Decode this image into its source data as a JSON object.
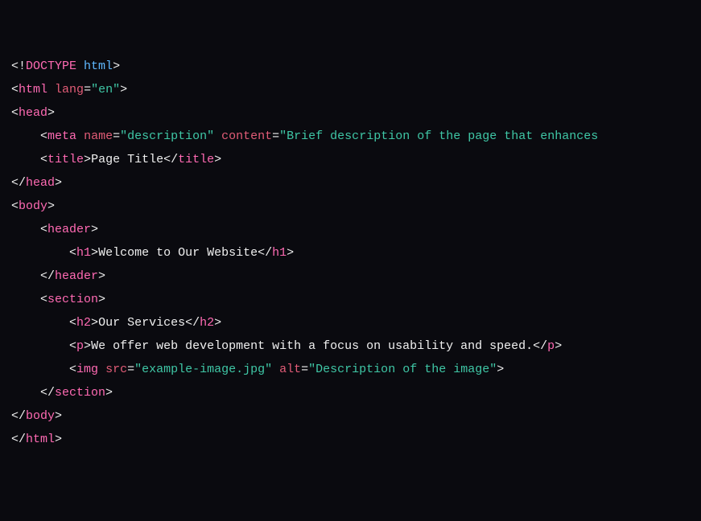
{
  "code": {
    "l1_open": "<!",
    "l1_doctype": "DOCTYPE",
    "l1_space": " ",
    "l1_html": "html",
    "l1_close": ">",
    "l2_open": "<",
    "l2_tag": "html",
    "l2_sp": " ",
    "l2_attr": "lang",
    "l2_eq": "=",
    "l2_val": "\"en\"",
    "l2_close": ">",
    "l3_open": "<",
    "l3_tag": "head",
    "l3_close": ">",
    "l4_indent": "    ",
    "l4_open": "<",
    "l4_tag": "meta",
    "l4_sp1": " ",
    "l4_attr1": "name",
    "l4_eq1": "=",
    "l4_val1": "\"description\"",
    "l4_sp2": " ",
    "l4_attr2": "content",
    "l4_eq2": "=",
    "l4_val2": "\"Brief description of the page that enhances ",
    "l5_indent": "    ",
    "l5_open": "<",
    "l5_tag": "title",
    "l5_close": ">",
    "l5_text": "Page Title",
    "l5_open2": "</",
    "l5_tag2": "title",
    "l5_close2": ">",
    "l6_open": "</",
    "l6_tag": "head",
    "l6_close": ">",
    "l7_open": "<",
    "l7_tag": "body",
    "l7_close": ">",
    "l8_indent": "    ",
    "l8_open": "<",
    "l8_tag": "header",
    "l8_close": ">",
    "l9_indent": "        ",
    "l9_open": "<",
    "l9_tag": "h1",
    "l9_close": ">",
    "l9_text": "Welcome to Our Website",
    "l9_open2": "</",
    "l9_tag2": "h1",
    "l9_close2": ">",
    "l10_indent": "    ",
    "l10_open": "</",
    "l10_tag": "header",
    "l10_close": ">",
    "l11_indent": "    ",
    "l11_open": "<",
    "l11_tag": "section",
    "l11_close": ">",
    "l12_indent": "        ",
    "l12_open": "<",
    "l12_tag": "h2",
    "l12_close": ">",
    "l12_text": "Our Services",
    "l12_open2": "</",
    "l12_tag2": "h2",
    "l12_close2": ">",
    "l13_indent": "        ",
    "l13_open": "<",
    "l13_tag": "p",
    "l13_close": ">",
    "l13_text": "We offer web development with a focus on usability and speed.",
    "l13_open2": "</",
    "l13_tag2": "p",
    "l13_close2": ">",
    "l14_indent": "        ",
    "l14_open": "<",
    "l14_tag": "img",
    "l14_sp1": " ",
    "l14_attr1": "src",
    "l14_eq1": "=",
    "l14_val1": "\"example-image.jpg\"",
    "l14_sp2": " ",
    "l14_attr2": "alt",
    "l14_eq2": "=",
    "l14_val2": "\"Description of the image\"",
    "l14_close": ">",
    "l15_indent": "    ",
    "l15_open": "</",
    "l15_tag": "section",
    "l15_close": ">",
    "l16_open": "</",
    "l16_tag": "body",
    "l16_close": ">",
    "l17_open": "</",
    "l17_tag": "html",
    "l17_close": ">"
  }
}
